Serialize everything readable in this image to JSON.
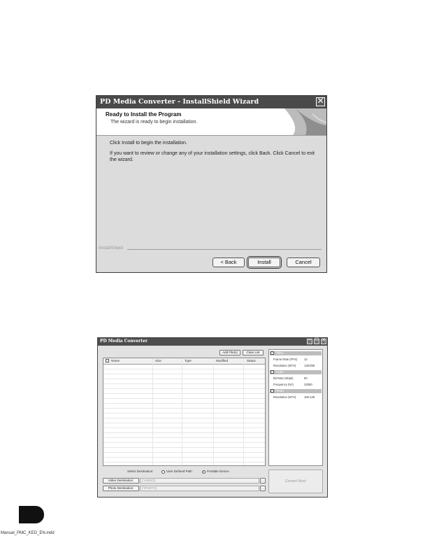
{
  "installer": {
    "title": "PD Media Converter - InstallShield Wizard",
    "close_icon": "close-icon",
    "header_title": "Ready to Install the Program",
    "header_subtitle": "The wizard is ready to begin installation.",
    "body_line1": "Click Install to begin the installation.",
    "body_line2": "If you want to review or change any of your installation settings, click Back. Click Cancel to exit the wizard.",
    "brand": "InstallShield",
    "buttons": {
      "back": "< Back",
      "install": "Install",
      "cancel": "Cancel"
    }
  },
  "converter": {
    "title": "PD Media Converter",
    "add_files": "Add File(s)",
    "clear_list": "Clear List",
    "columns": [
      "Name",
      "Size",
      "Type",
      "Modified",
      "Status"
    ],
    "properties": {
      "video_label": "Video",
      "frame_rate_label": "Frame Rate (FPS)",
      "frame_rate_value": "12",
      "video_resolution_label": "Resolution (W*H)",
      "video_resolution_value": "128:059",
      "audio_label": "Audio",
      "bit_rate_label": "Bit Rate (Kbps)",
      "bit_rate_value": "60",
      "frequency_label": "Frequency (Hz)",
      "frequency_value": "22050",
      "photo_label": "Photo",
      "photo_resolution_label": "Resolution (W*H)",
      "photo_resolution_value": "160:128"
    },
    "select_destination": "Select Destination:",
    "user_defined_path": "User Defined Path",
    "portable_device": "Portable Device",
    "video_destination": "Video Destination:",
    "video_path": "[:\\VIDEO]",
    "photo_destination": "Photo Destination:",
    "photo_path": "[:\\PHOTO]",
    "browse": "...",
    "convert_now": "Convert Now!"
  },
  "footer": {
    "text": "Manual_PMC_KED_EN.indd"
  }
}
